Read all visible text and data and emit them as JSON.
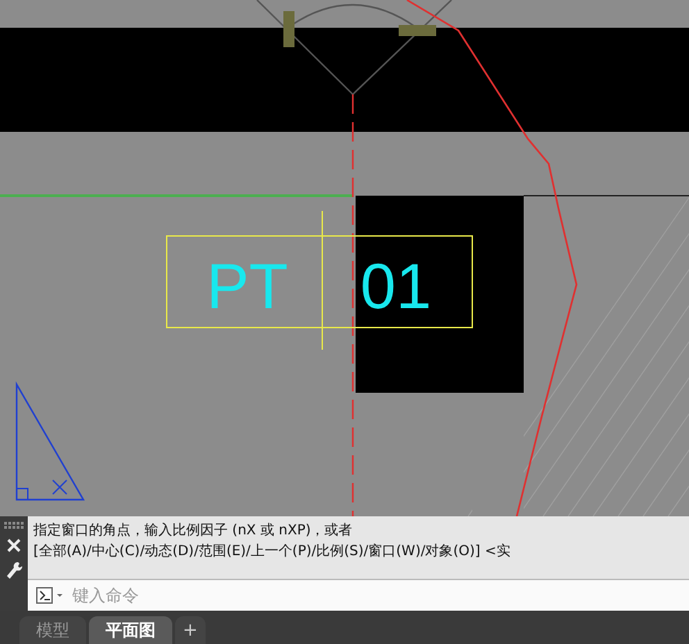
{
  "drawing": {
    "labels": [
      "PT",
      "01"
    ]
  },
  "command_line": {
    "history": [
      "指定窗口的角点，输入比例因子 (nX 或 nXP)，或者",
      "[全部(A)/中心(C)/动态(D)/范围(E)/上一个(P)/比例(S)/窗口(W)/对象(O)] <实"
    ],
    "input": {
      "placeholder": "键入命令"
    }
  },
  "layout_tabs": [
    {
      "label": "模型",
      "selected": false
    },
    {
      "label": "平面图",
      "selected": true
    }
  ],
  "add_tab": {
    "label": "+"
  }
}
